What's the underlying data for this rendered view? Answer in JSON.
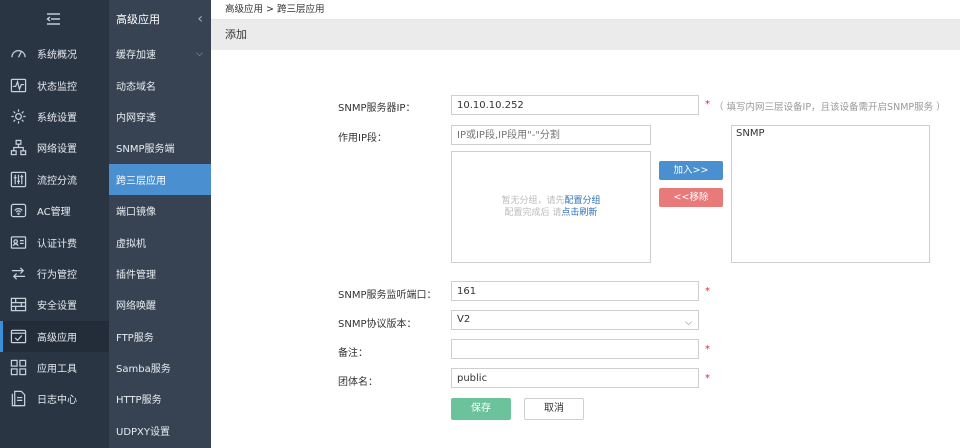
{
  "nav": {
    "menu_icon": "menu-collapse-icon",
    "items": [
      {
        "label": "系统概况",
        "icon": "dashboard-gauge-icon"
      },
      {
        "label": "状态监控",
        "icon": "pulse-monitor-icon"
      },
      {
        "label": "系统设置",
        "icon": "gear-icon"
      },
      {
        "label": "网络设置",
        "icon": "network-tree-icon"
      },
      {
        "label": "流控分流",
        "icon": "sliders-icon"
      },
      {
        "label": "AC管理",
        "icon": "wifi-ap-icon"
      },
      {
        "label": "认证计费",
        "icon": "id-card-icon"
      },
      {
        "label": "行为管控",
        "icon": "arrows-swap-icon"
      },
      {
        "label": "安全设置",
        "icon": "firewall-icon"
      },
      {
        "label": "高级应用",
        "icon": "check-window-icon"
      },
      {
        "label": "应用工具",
        "icon": "apps-grid-icon"
      },
      {
        "label": "日志中心",
        "icon": "log-document-icon"
      }
    ]
  },
  "subnav": {
    "title": "高级应用",
    "items": [
      {
        "label": "缓存加速"
      },
      {
        "label": "动态域名"
      },
      {
        "label": "内网穿透"
      },
      {
        "label": "SNMP服务端"
      },
      {
        "label": "跨三层应用"
      },
      {
        "label": "端口镜像"
      },
      {
        "label": "虚拟机"
      },
      {
        "label": "插件管理"
      },
      {
        "label": "网络唤醒"
      },
      {
        "label": "FTP服务"
      },
      {
        "label": "Samba服务"
      },
      {
        "label": "HTTP服务"
      },
      {
        "label": "UDPXY设置"
      }
    ]
  },
  "breadcrumb": "高级应用 > 跨三层应用",
  "page_title": "添加",
  "form": {
    "snmp_ip": {
      "label": "SNMP服务器IP：",
      "value": "10.10.10.252",
      "required": "*",
      "hint": "（ 填写内网三层设备IP，且该设备需开启SNMP服务 ）"
    },
    "ip_range": {
      "label": "作用IP段：",
      "placeholder": "IP或IP段,IP段用\"-\"分割"
    },
    "group_box": {
      "line1_prefix": "暂无分组，请先",
      "line1_link": "配置分组",
      "line2_prefix": "配置完成后 请",
      "line2_link": "点击刷新"
    },
    "add_button": "加入>>",
    "remove_button": "<<移除",
    "selected_box_item": "SNMP",
    "port": {
      "label": "SNMP服务监听端口：",
      "value": "161",
      "required": "*"
    },
    "version": {
      "label": "SNMP协议版本：",
      "value": "V2"
    },
    "note": {
      "label": "备注：",
      "value": "",
      "required": "*"
    },
    "community": {
      "label": "团体名：",
      "value": "public",
      "required": "*"
    },
    "save_button": "保存",
    "cancel_button": "取消"
  },
  "colors": {
    "sidebar_primary": "#2a3544",
    "sidebar_secondary": "#374352",
    "active_item": "#4a8fd0",
    "add_button": "#4a8fd0",
    "remove_button": "#e87a7a",
    "save_button": "#6cc39b",
    "link": "#2f6fb8",
    "required": "#ee2233"
  }
}
